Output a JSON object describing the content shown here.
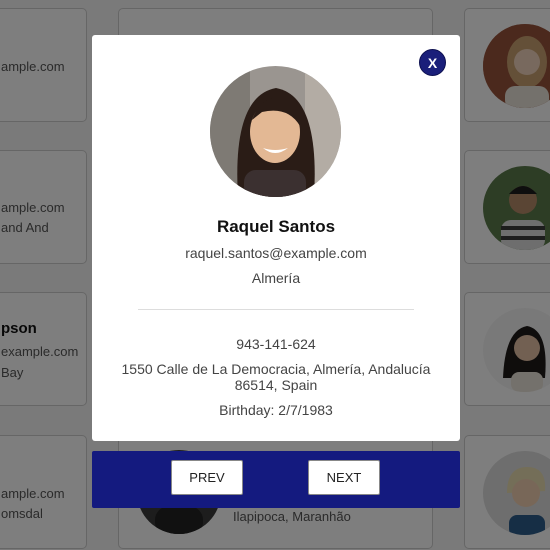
{
  "background_cards": {
    "left": [
      {
        "lines": [
          "ample.com"
        ]
      },
      {
        "lines": [
          "ample.com",
          "and And"
        ]
      },
      {
        "name": "pson",
        "lines": [
          "example.com",
          "Bay"
        ]
      },
      {
        "lines": [
          "ample.com",
          "omsdal"
        ]
      }
    ],
    "center_bottom": {
      "city": "Ilapipoca, Maranhão"
    }
  },
  "modal": {
    "close_label": "X",
    "name": "Raquel Santos",
    "email": "raquel.santos@example.com",
    "city": "Almería",
    "phone": "943-141-624",
    "address": "1550 Calle de La Democracia, Almería, Andalucía 86514, Spain",
    "birthday": "Birthday: 2/7/1983"
  },
  "navigation": {
    "prev_label": "PREV",
    "next_label": "NEXT"
  },
  "colors": {
    "accent": "#141a7f",
    "overlay": "rgba(0,0,0,0.5)"
  }
}
